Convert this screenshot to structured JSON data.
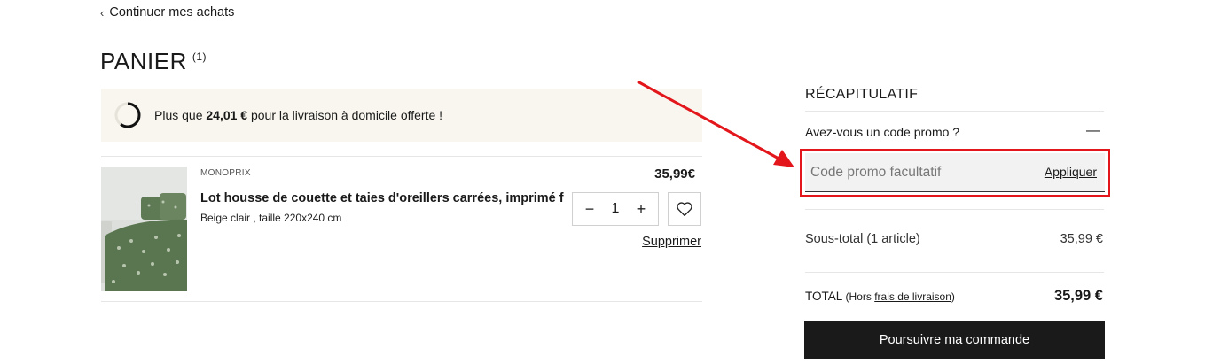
{
  "nav": {
    "back_label": "Continuer mes achats"
  },
  "cart": {
    "title": "PANIER",
    "count": "(1)",
    "shipping_banner": {
      "prefix": "Plus que ",
      "amount": "24,01 €",
      "suffix": " pour la livraison à domicile offerte !",
      "progress": 0.6
    },
    "items": [
      {
        "brand": "MONOPRIX",
        "title": "Lot housse de couette et taies d'oreillers carrées, imprimé fl...",
        "variant": "Beige clair , taille 220x240 cm",
        "price": "35,99€",
        "quantity": "1",
        "remove_label": "Supprimer"
      }
    ]
  },
  "summary": {
    "title": "RÉCAPITULATIF",
    "promo_question": "Avez-vous un code promo ?",
    "promo_toggle": "—",
    "promo_placeholder": "Code promo facultatif",
    "apply_label": "Appliquer",
    "subtotal_label": "Sous-total (1 article)",
    "subtotal_value": "35,99 €",
    "total_label": "TOTAL",
    "total_note_prefix": "(Hors ",
    "total_note_link": "frais de livraison",
    "total_note_suffix": ")",
    "total_value": "35,99 €",
    "checkout_label": "Poursuivre ma commande"
  },
  "colors": {
    "accent_highlight": "#e3161b",
    "banner_bg": "#f8f6ee",
    "checkout_bg": "#1a1a1a"
  }
}
